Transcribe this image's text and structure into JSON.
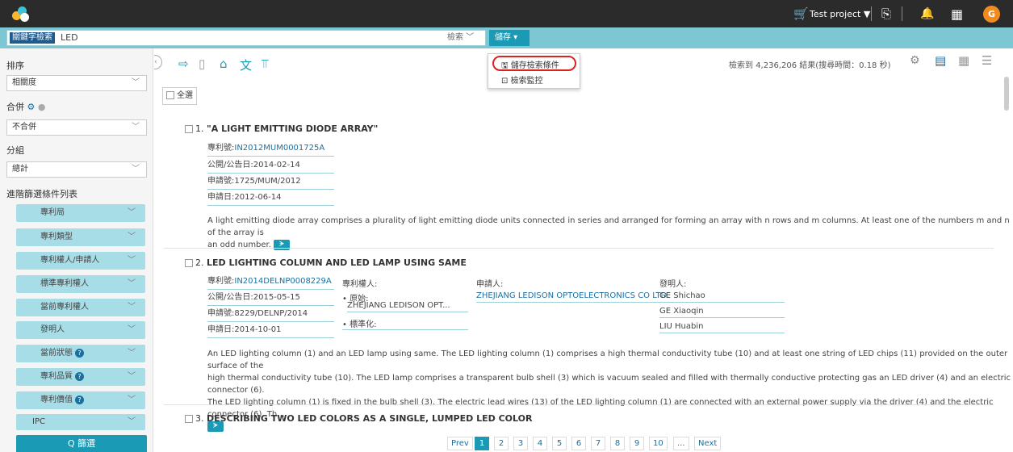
{
  "topbar": {
    "project": "Test project ▼",
    "avatar": "G"
  },
  "search": {
    "mode_badge": "關鍵字檢索",
    "query": "LED",
    "search_label": "檢索 ﹀",
    "save_label": "儲存 ▾"
  },
  "save_menu": {
    "items": [
      "儲存檢索條件",
      "檢索監控"
    ]
  },
  "sidebar": {
    "sort_label": "排序",
    "sort_value": "相關度",
    "merge_label": "合併",
    "merge_value": "不合併",
    "group_label": "分組",
    "group_value": "總計",
    "filter_list_label": "進階篩選條件列表",
    "facets": [
      "專利局",
      "專利類型",
      "專利權人/申請人",
      "標準專利權人",
      "當前專利權人",
      "發明人",
      "當前狀態",
      "專利品質",
      "專利價值",
      "IPC"
    ],
    "filter_button": "Q 篩選"
  },
  "results": {
    "count_text": "檢索到 4,236,206 結果(搜尋時間：0.18 秒)",
    "select_all": "全選",
    "items": [
      {
        "num": "1.",
        "title": "\"A LIGHT EMITTING DIODE ARRAY\"",
        "patent_no_label": "專利號:",
        "patent_no": "IN2012MUM0001725A",
        "pub_date": "公開/公告日:2014-02-14",
        "app_no": "申請號:1725/MUM/2012",
        "app_date": "申請日:2012-06-14",
        "abstract_l1": "A light emitting diode array comprises a plurality of light emitting diode units connected in series and arranged for forming an array with n rows and m columns. At least one of the numbers m and n of the array is",
        "abstract_l2": "an odd number."
      },
      {
        "num": "2.",
        "title": "LED LIGHTING COLUMN AND LED LAMP USING SAME",
        "patent_no_label": "專利號:",
        "patent_no": "IN2014DELNP0008229A",
        "pub_date": "公開/公告日:2015-05-15",
        "app_no": "申請號:8229/DELNP/2014",
        "app_date": "申請日:2014-10-01",
        "assignee_label": "專利權人:",
        "orig_label": "• 原始:",
        "orig_value": "ZHEJIANG LEDISON OPT...",
        "std_label": "• 標準化:",
        "applicant_label": "申請人:",
        "applicant_value": "ZHEJIANG LEDISON OPTOELECTRONICS CO LTD.",
        "inventor_label": "發明人:",
        "inventors": [
          "GE Shichao",
          "GE Xiaoqin",
          "LIU Huabin"
        ],
        "abstract_l1": "An LED lighting column (1) and an LED lamp using same. The LED lighting column (1) comprises a high thermal conductivity tube (10) and at least one string of LED chips (11) provided on the outer surface of the",
        "abstract_l2": "high thermal conductivity tube (10). The LED lamp comprises a transparent bulb shell (3) which is vacuum sealed and filled with thermally conductive protecting gas an LED driver (4) and an electric connector (6).",
        "abstract_l3": "The LED lighting column (1) is fixed in the bulb shell (3). The electric lead wires (13) of the LED lighting column (1) are connected with an external power supply via the driver (4) and the electric connector (6). Th..."
      },
      {
        "num": "3.",
        "title": "DESCRIBING TWO LED COLORS AS A SINGLE, LUMPED LED COLOR"
      }
    ]
  },
  "pagination": {
    "prev": "Prev",
    "pages": [
      "1",
      "2",
      "3",
      "4",
      "5",
      "6",
      "7",
      "8",
      "9",
      "10"
    ],
    "ellipsis": "...",
    "next": "Next"
  }
}
